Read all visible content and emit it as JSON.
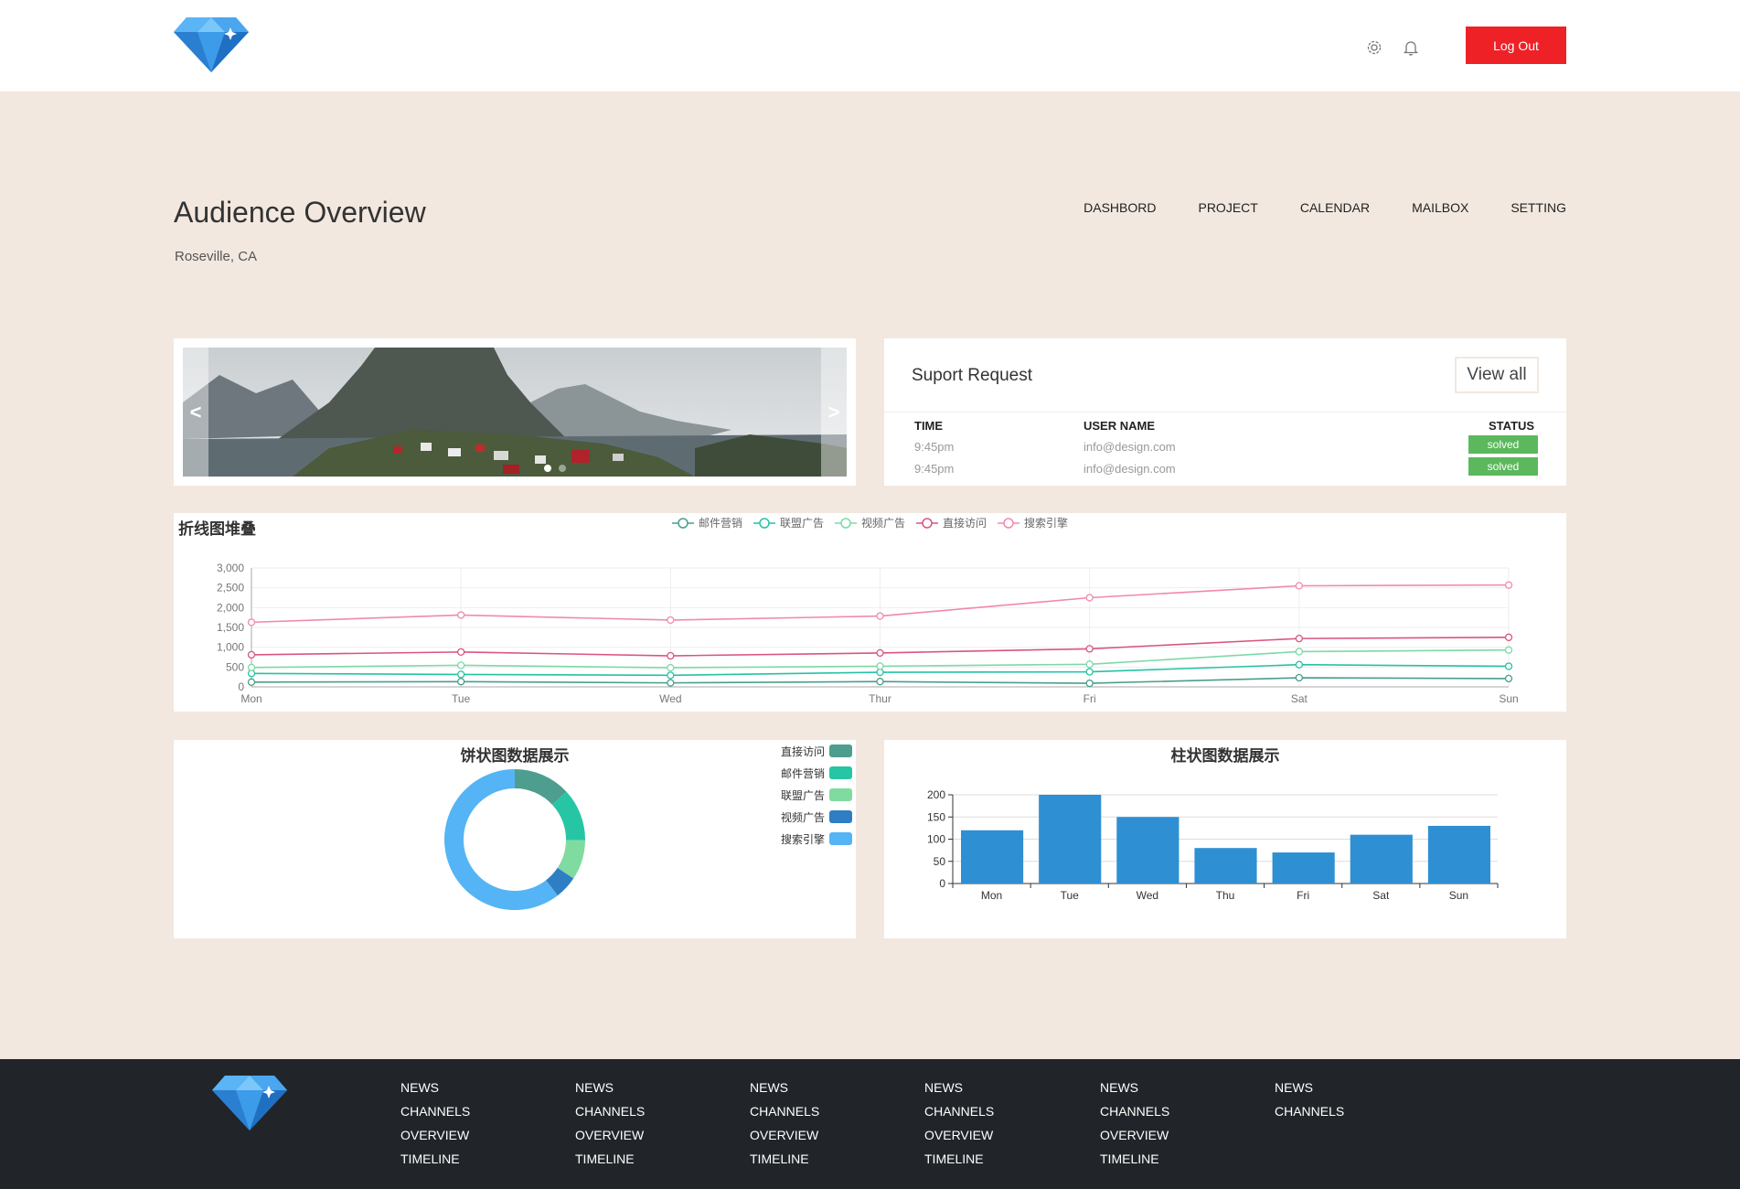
{
  "header": {
    "logout_label": "Log Out",
    "icons": [
      "gear-icon",
      "bell-icon"
    ],
    "accent": "#ee2127"
  },
  "page": {
    "title": "Audience Overview",
    "subtitle": "Roseville, CA"
  },
  "nav": {
    "items": [
      {
        "label": "DASHBORD"
      },
      {
        "label": "PROJECT"
      },
      {
        "label": "CALENDAR"
      },
      {
        "label": "MAILBOX"
      },
      {
        "label": "SETTING"
      }
    ]
  },
  "slider": {
    "prev": "<",
    "next": ">",
    "slide_count": 2,
    "active_slide": 1
  },
  "support": {
    "title": "Suport Request",
    "view_all_label": "View all",
    "columns": {
      "time": "TIME",
      "user": "USER NAME",
      "status": "STATUS"
    },
    "rows": [
      {
        "time": "9:45pm",
        "user": "info@design.com",
        "status": "solved"
      },
      {
        "time": "9:45pm",
        "user": "info@design.com",
        "status": "solved"
      }
    ],
    "status_color": "#5cb85c"
  },
  "chart_data": [
    {
      "type": "line",
      "title": "折线图堆叠",
      "categories": [
        "Mon",
        "Tue",
        "Wed",
        "Thur",
        "Fri",
        "Sat",
        "Sun"
      ],
      "y_ticks": [
        "0",
        "500",
        "1,000",
        "1,500",
        "2,000",
        "2,500",
        "3,000"
      ],
      "ylim": [
        0,
        3000
      ],
      "stacked": true,
      "grid": true,
      "legend_position": "top-center",
      "series": [
        {
          "name": "邮件营销",
          "color": "#4a9e8c",
          "values": [
            120,
            132,
            101,
            134,
            90,
            230,
            210
          ]
        },
        {
          "name": "联盟广告",
          "color": "#25c2a4",
          "values": [
            340,
            314,
            292,
            368,
            380,
            560,
            520
          ]
        },
        {
          "name": "视频广告",
          "color": "#7ed8a8",
          "values": [
            490,
            545,
            483,
            522,
            570,
            890,
            930
          ]
        },
        {
          "name": "直接访问",
          "color": "#d9557e",
          "values": [
            810,
            880,
            784,
            856,
            960,
            1220,
            1250
          ]
        },
        {
          "name": "搜索引擎",
          "color": "#f08aa8",
          "values": [
            1630,
            1812,
            1685,
            1786,
            2250,
            2550,
            2570
          ]
        }
      ]
    },
    {
      "type": "pie",
      "title": "饼状图数据展示",
      "donut": true,
      "legend_position": "top-right",
      "series": [
        {
          "name": "直接访问",
          "color": "#4d9e8f",
          "value": 335
        },
        {
          "name": "邮件营销",
          "color": "#26c6a5",
          "value": 310
        },
        {
          "name": "联盟广告",
          "color": "#7fdb9f",
          "value": 234
        },
        {
          "name": "视频广告",
          "color": "#2f7ec3",
          "value": 135
        },
        {
          "name": "搜索引擎",
          "color": "#54b4f5",
          "value": 1548
        }
      ]
    },
    {
      "type": "bar",
      "title": "柱状图数据展示",
      "categories": [
        "Mon",
        "Tue",
        "Wed",
        "Thu",
        "Fri",
        "Sat",
        "Sun"
      ],
      "values": [
        120,
        200,
        150,
        80,
        70,
        110,
        130
      ],
      "y_ticks": [
        "0",
        "50",
        "100",
        "150",
        "200"
      ],
      "ylim": [
        0,
        200
      ],
      "color": "#2f8fd3",
      "grid": true
    }
  ],
  "footer": {
    "columns": [
      [
        "NEWS",
        "CHANNELS",
        "OVERVIEW",
        "TIMELINE"
      ],
      [
        "NEWS",
        "CHANNELS",
        "OVERVIEW",
        "TIMELINE"
      ],
      [
        "NEWS",
        "CHANNELS",
        "OVERVIEW",
        "TIMELINE"
      ],
      [
        "NEWS",
        "CHANNELS",
        "OVERVIEW",
        "TIMELINE"
      ],
      [
        "NEWS",
        "CHANNELS",
        "OVERVIEW",
        "TIMELINE"
      ],
      [
        "NEWS",
        "CHANNELS"
      ]
    ]
  }
}
